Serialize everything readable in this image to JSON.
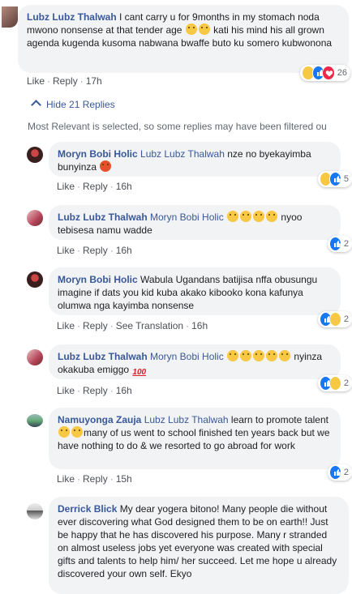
{
  "top_comment": {
    "author": "Lubz Lubz Thalwah",
    "text": "I cant carry u for 9months in my stomach noda mwono nonsense at that tender age",
    "text2": "kati his mind his all grown agenda kugenda kusoma nabwana bwaffe buto ku somero kubwonona",
    "like": "Like",
    "reply": "Reply",
    "time": "17h",
    "reactions": "26"
  },
  "replies_toggle": "Hide 21 Replies",
  "filter_note": "Most Relevant is selected, so some replies may have been filtered ou",
  "replies": [
    {
      "author": "Moryn Bobi Holic",
      "mention": "Lubz Lubz Thalwah",
      "text": "nze no byekayimba bunyinza",
      "like": "Like",
      "reply": "Reply",
      "time": "16h",
      "reactions": "5"
    },
    {
      "author": "Lubz Lubz Thalwah",
      "mention": "Moryn Bobi Holic",
      "text": "nyoo tebisesa namu wadde",
      "like": "Like",
      "reply": "Reply",
      "time": "16h",
      "reactions": "2"
    },
    {
      "author": "Moryn Bobi Holic",
      "text": "Wabula Ugandans batijisa nffa obusungu imagine if dats you kid kuba akako kibooko kona kafunya olumwa nga kayimba nonsense",
      "like": "Like",
      "reply": "Reply",
      "translate": "See Translation",
      "time": "16h",
      "reactions": "2"
    },
    {
      "author": "Lubz Lubz Thalwah",
      "mention": "Moryn Bobi Holic",
      "text": "nyinza okakuba emiggo",
      "like": "Like",
      "reply": "Reply",
      "time": "16h",
      "reactions": "2"
    },
    {
      "author": "Namuyonga Zauja",
      "mention": "Lubz Lubz Thalwah",
      "text_a": "learn to promote talent",
      "text_b": "many of us went to school finished ten years back but we have nothing to do & we resorted to go abroad for work",
      "like": "Like",
      "reply": "Reply",
      "time": "15h",
      "reactions": "2"
    },
    {
      "author": "Derrick Blick",
      "text": "My dear yogera bitono! Many people die without ever discovering what God designed them to be on earth!! Just be happy that he has discovered his purpose. Many r stranded on almost useless jobs yet everyone was created with special gifts and talents to help him/ her succeed. Let me hope u already discovered your own self. Ekyo"
    }
  ]
}
